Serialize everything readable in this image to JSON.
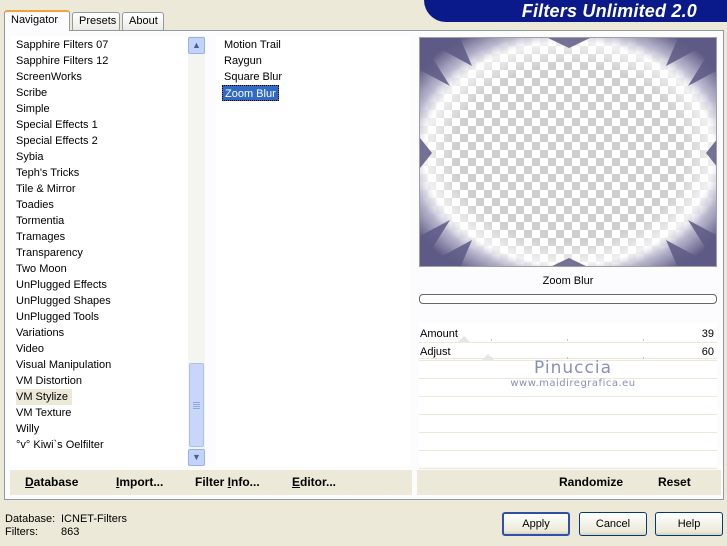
{
  "banner": {
    "title": "Filters Unlimited 2.0"
  },
  "tabs": [
    {
      "label": "Navigator",
      "active": true
    },
    {
      "label": "Presets",
      "active": false
    },
    {
      "label": "About",
      "active": false
    }
  ],
  "categories": [
    "Sapphire Filters 07",
    "Sapphire Filters 12",
    "ScreenWorks",
    "Scribe",
    "Simple",
    "Special Effects 1",
    "Special Effects 2",
    "Sybia",
    "Teph's Tricks",
    "Tile & Mirror",
    "Toadies",
    "Tormentia",
    "Tramages",
    "Transparency",
    "Two Moon",
    "UnPlugged Effects",
    "UnPlugged Shapes",
    "UnPlugged Tools",
    "Variations",
    "Video",
    "Visual Manipulation",
    "VM Distortion",
    "VM Stylize",
    "VM Texture",
    "Willy",
    "°v° Kiwi`s Oelfilter"
  ],
  "selected_category": "VM Stylize",
  "filters": [
    "Motion Trail",
    "Raygun",
    "Square Blur",
    "Zoom Blur"
  ],
  "selected_filter": "Zoom Blur",
  "preview": {
    "filter_name": "Zoom Blur",
    "progress": 0
  },
  "params": [
    {
      "label": "Amount",
      "value": "39",
      "fraction": 0.15
    },
    {
      "label": "Adjust",
      "value": "60",
      "fraction": 0.23
    }
  ],
  "watermark": {
    "line1": "Pinuccia",
    "line2": "www.maidiregrafica.eu"
  },
  "toolbar_left": [
    {
      "label": "Database",
      "key": "D",
      "rest": "atabase"
    },
    {
      "label": "Import...",
      "key": "I",
      "rest": "mport..."
    },
    {
      "label": "Filter Info...",
      "pre": "Filter ",
      "key": "I",
      "rest": "nfo..."
    },
    {
      "label": "Editor...",
      "key": "E",
      "rest": "ditor..."
    }
  ],
  "toolbar_right": {
    "randomize": "Randomize",
    "reset": "Reset"
  },
  "status": {
    "database_label": "Database:",
    "database_value": "ICNET-Filters",
    "filters_label": "Filters:",
    "filters_value": "863"
  },
  "buttons": {
    "apply": "Apply",
    "cancel": "Cancel",
    "help": "Help"
  },
  "colors": {
    "banner": "#0a1a8a",
    "selection": "#316ac5",
    "preview_tint": "#5d5a85"
  }
}
